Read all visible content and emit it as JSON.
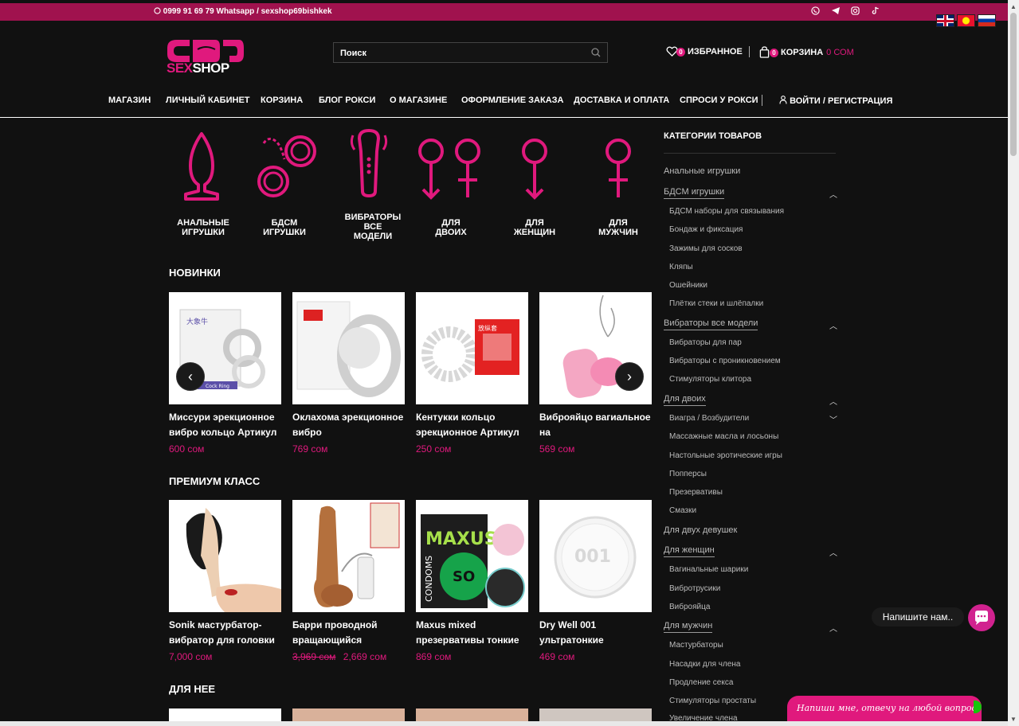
{
  "topbar": {
    "contact": "0999 91 69 79 Whatsapp / sexshop69bishkek",
    "social": [
      "whatsapp-icon",
      "telegram-icon",
      "instagram-icon",
      "tiktok-icon"
    ]
  },
  "languages": [
    "English",
    "Кыргызча",
    "Русский"
  ],
  "logo": {
    "word1": "SEX",
    "word2": "SHOP"
  },
  "search": {
    "placeholder": "Поиск"
  },
  "header": {
    "favorites_label": "ИЗБРАННОЕ",
    "favorites_count": "0",
    "cart_label": "КОРЗИНА",
    "cart_count": "0",
    "cart_sum": "0 СОМ"
  },
  "nav": [
    "МАГАЗИН",
    "ЛИЧНЫЙ КАБИНЕТ",
    "КОРЗИНА",
    "БЛОГ РОКСИ",
    "О МАГАЗИНЕ",
    "ОФОРМЛЕНИЕ ЗАКАЗА",
    "ДОСТАВКА И ОПЛАТА",
    "СПРОСИ У РОКСИ"
  ],
  "login": "ВОЙТИ / РЕГИСТРАЦИЯ",
  "categories_icons": [
    {
      "line1": "АНАЛЬНЫЕ",
      "line2": "ИГРУШКИ",
      "line3": ""
    },
    {
      "line1": "БДСМ",
      "line2": "ИГРУШКИ",
      "line3": ""
    },
    {
      "line1": "ВИБРАТОРЫ",
      "line2": "ВСЕ",
      "line3": "МОДЕЛИ"
    },
    {
      "line1": "ДЛЯ",
      "line2": "ДВОИХ",
      "line3": ""
    },
    {
      "line1": "ДЛЯ",
      "line2": "ЖЕНЩИН",
      "line3": ""
    },
    {
      "line1": "ДЛЯ",
      "line2": "МУЖЧИН",
      "line3": ""
    }
  ],
  "sections": {
    "new": "НОВИНКИ",
    "premium": "ПРЕМИУМ КЛАСС",
    "for_her": "ДЛЯ НЕЕ"
  },
  "new_products": [
    {
      "name": "Миссури эрекционное вибро кольцо Артикул",
      "price": "600 сом"
    },
    {
      "name": "Оклахома эрекционное вибро",
      "price": "769 сом"
    },
    {
      "name": "Кентукки кольцо эрекционное Артикул",
      "price": "250 сом"
    },
    {
      "name": "Виброяйцо вагиальное на",
      "price": "569 сом"
    }
  ],
  "premium_products": [
    {
      "name": "Sonik мастурбатор-вибратор для головки",
      "price": "7,000 сом",
      "old_price": ""
    },
    {
      "name": "Барри проводной вращающийся",
      "price": "2,669 сом",
      "old_price": "3,969 сом"
    },
    {
      "name": "Maxus mixed презервативы тонкие",
      "price": "869 сом",
      "old_price": ""
    },
    {
      "name": "Dry Well 001 ультратонкие",
      "price": "469 сом",
      "old_price": ""
    }
  ],
  "product_images": {
    "p1_brand": "Cock Ring",
    "p3_box": "放纵套",
    "p7_brand": "MAXUS",
    "p7_side": "CONDOMS",
    "p7_badge": "SO",
    "p8_label": "001"
  },
  "sidebar": {
    "title": "КАТЕГОРИИ ТОВАРОВ",
    "items": [
      {
        "label": "Анальные игрушки"
      },
      {
        "label": "БДСМ игрушки"
      },
      {
        "label": "БДСМ наборы для связывания"
      },
      {
        "label": "Бондаж и фиксация"
      },
      {
        "label": "Зажимы для сосков"
      },
      {
        "label": "Кляпы"
      },
      {
        "label": "Ошейники"
      },
      {
        "label": "Плётки стеки и шлёпалки"
      },
      {
        "label": "Вибраторы все модели"
      },
      {
        "label": "Вибраторы для пар"
      },
      {
        "label": "Вибраторы с проникновением"
      },
      {
        "label": "Стимуляторы клитора"
      },
      {
        "label": "Для двоих"
      },
      {
        "label": "Виагра / Возбудители"
      },
      {
        "label": "Массажные масла и лосьоны"
      },
      {
        "label": "Настольные эротические игры"
      },
      {
        "label": "Попперсы"
      },
      {
        "label": "Презервативы"
      },
      {
        "label": "Смазки"
      },
      {
        "label": "Для двух девушек"
      },
      {
        "label": "Для женщин"
      },
      {
        "label": "Вагинальные шарики"
      },
      {
        "label": "Вибротрусики"
      },
      {
        "label": "Виброяйца"
      },
      {
        "label": "Для мужчин"
      },
      {
        "label": "Мастурбаторы"
      },
      {
        "label": "Насадки для члена"
      },
      {
        "label": "Продление секса"
      },
      {
        "label": "Стимуляторы простаты"
      },
      {
        "label": "Увеличение члена"
      }
    ]
  },
  "chat": {
    "bubble": "Напишите нам..",
    "tab": "Напиши мне, отвечу на любой вопрос)"
  },
  "colors": {
    "accent": "#e0197d",
    "topbar": "#a0124e",
    "background": "#111111"
  }
}
